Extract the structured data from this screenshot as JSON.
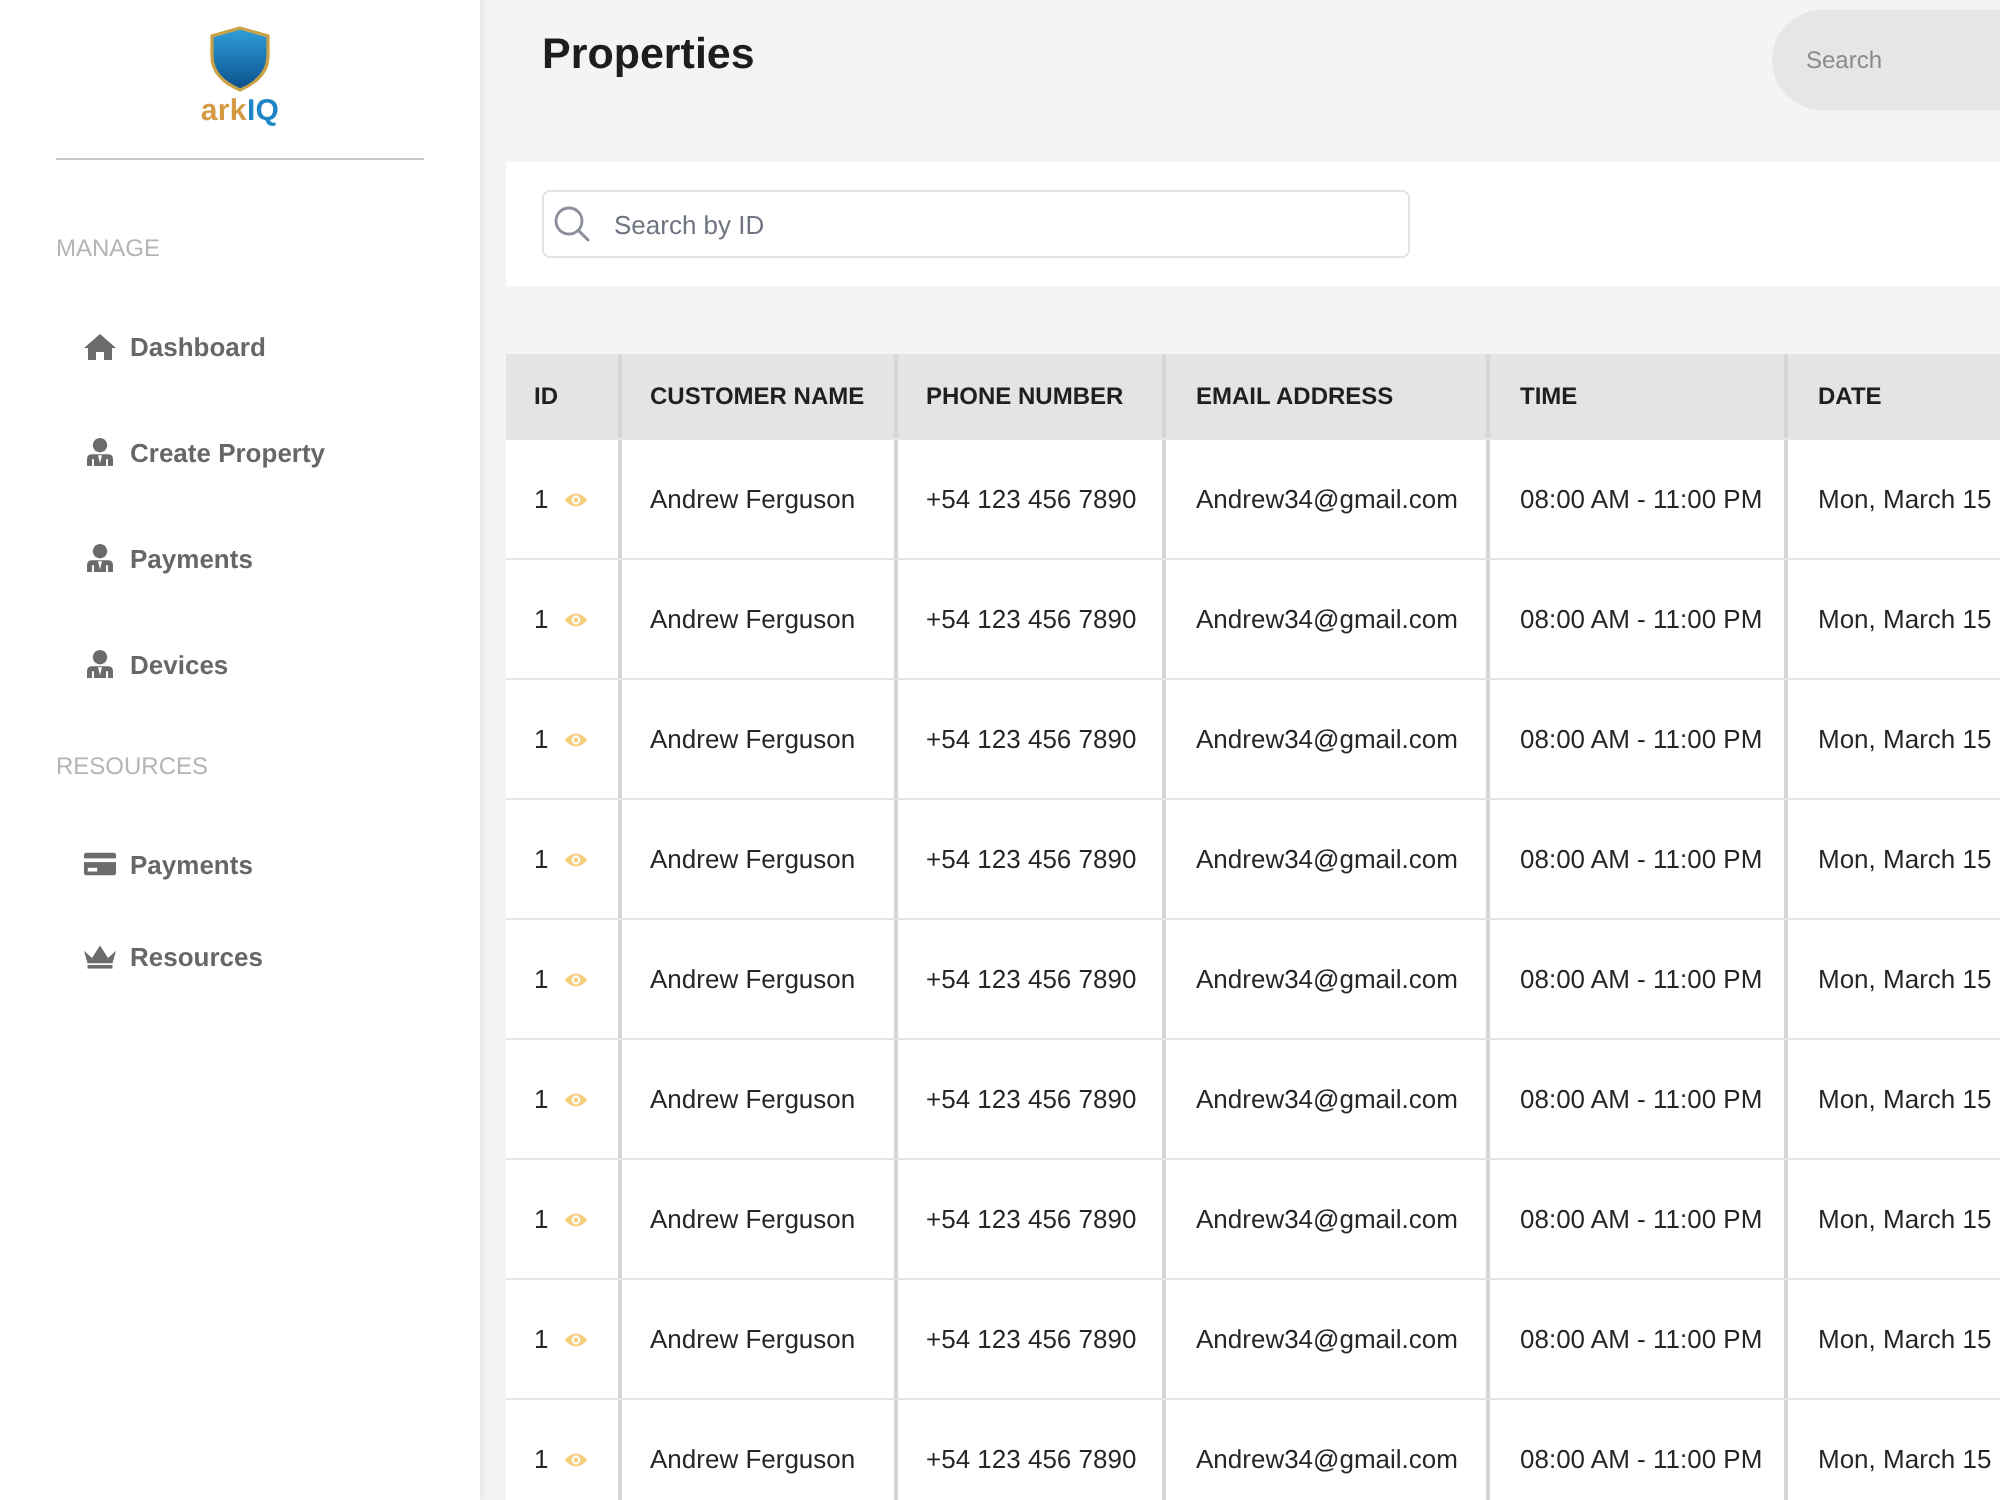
{
  "sidebar": {
    "logo": {
      "text": [
        "ark",
        "IQ"
      ]
    },
    "sections": [
      {
        "heading": "MANAGE",
        "items": [
          {
            "label": "Dashboard",
            "kind": "home"
          },
          {
            "label": "Create Property",
            "kind": "person"
          },
          {
            "label": "Payments",
            "kind": "person"
          },
          {
            "label": "Devices",
            "kind": "person"
          }
        ]
      },
      {
        "heading": "RESOURCES",
        "items": [
          {
            "label": "Payments",
            "kind": "card"
          },
          {
            "label": "Resources",
            "kind": "crown"
          }
        ]
      }
    ]
  },
  "header": {
    "title": "Properties",
    "search": {
      "placeholder": "Search"
    }
  },
  "filter": {
    "search": {
      "placeholder": "Search by ID"
    }
  },
  "table": {
    "columns": [
      "ID",
      "CUSTOMER NAME",
      "PHONE NUMBER",
      "EMAIL ADDRESS",
      "TIME",
      "DATE"
    ],
    "rows": [
      [
        "1",
        "Andrew Ferguson",
        "+54 123 456 7890",
        "Andrew34@gmail.com",
        "08:00 AM - 11:00 PM",
        "Mon, March 15"
      ],
      [
        "1",
        "Andrew Ferguson",
        "+54 123 456 7890",
        "Andrew34@gmail.com",
        "08:00 AM - 11:00 PM",
        "Mon, March 15"
      ],
      [
        "1",
        "Andrew Ferguson",
        "+54 123 456 7890",
        "Andrew34@gmail.com",
        "08:00 AM - 11:00 PM",
        "Mon, March 15"
      ],
      [
        "1",
        "Andrew Ferguson",
        "+54 123 456 7890",
        "Andrew34@gmail.com",
        "08:00 AM - 11:00 PM",
        "Mon, March 15"
      ],
      [
        "1",
        "Andrew Ferguson",
        "+54 123 456 7890",
        "Andrew34@gmail.com",
        "08:00 AM - 11:00 PM",
        "Mon, March 15"
      ],
      [
        "1",
        "Andrew Ferguson",
        "+54 123 456 7890",
        "Andrew34@gmail.com",
        "08:00 AM - 11:00 PM",
        "Mon, March 15"
      ],
      [
        "1",
        "Andrew Ferguson",
        "+54 123 456 7890",
        "Andrew34@gmail.com",
        "08:00 AM - 11:00 PM",
        "Mon, March 15"
      ],
      [
        "1",
        "Andrew Ferguson",
        "+54 123 456 7890",
        "Andrew34@gmail.com",
        "08:00 AM - 11:00 PM",
        "Mon, March 15"
      ],
      [
        "1",
        "Andrew Ferguson",
        "+54 123 456 7890",
        "Andrew34@gmail.com",
        "08:00 AM - 11:00 PM",
        "Mon, March 15"
      ]
    ]
  }
}
